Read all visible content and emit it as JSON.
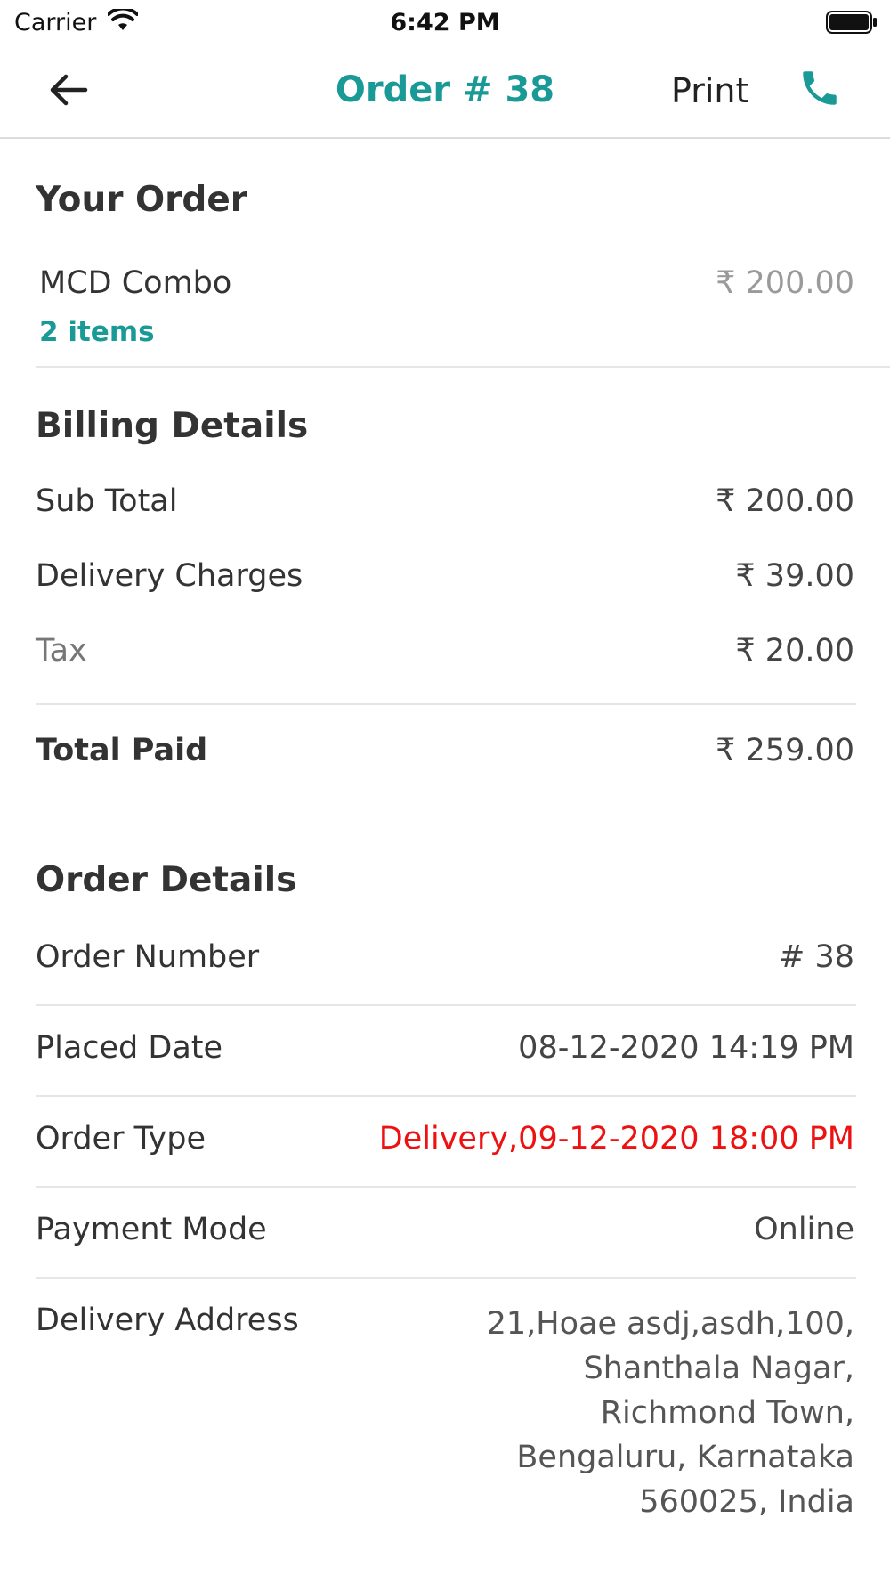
{
  "status_bar": {
    "carrier": "Carrier",
    "time": "6:42 PM",
    "wifi_icon": "wifi-icon",
    "battery_icon": "battery-icon"
  },
  "header": {
    "back_icon": "arrow-left-icon",
    "title": "Order # 38",
    "print_label": "Print",
    "phone_icon": "phone-icon",
    "accent_color": "#1a9a96"
  },
  "your_order": {
    "title": "Your Order",
    "item_name": "MCD Combo",
    "item_count": "2 items",
    "item_price": "₹ 200.00"
  },
  "billing": {
    "title": "Billing Details",
    "rows": [
      {
        "label": "Sub Total",
        "value": "₹ 200.00"
      },
      {
        "label": "Delivery Charges",
        "value": "₹ 39.00"
      },
      {
        "label": "Tax",
        "value": "₹ 20.00"
      }
    ],
    "total_label": "Total Paid",
    "total_value": "₹ 259.00"
  },
  "order_details": {
    "title": "Order Details",
    "rows": [
      {
        "label": "Order Number",
        "value": "# 38"
      },
      {
        "label": "Placed Date",
        "value": "08-12-2020 14:19 PM"
      },
      {
        "label": "Order Type",
        "value": "Delivery,09-12-2020 18:00 PM"
      },
      {
        "label": "Payment Mode",
        "value": "Online"
      }
    ],
    "address_label": "Delivery Address",
    "address_lines": [
      "21,Hoae asdj,asdh,100,",
      "Shanthala Nagar,",
      "Richmond Town,",
      "Bengaluru, Karnataka",
      "560025, India"
    ],
    "highlight_color": "#ee1111"
  }
}
